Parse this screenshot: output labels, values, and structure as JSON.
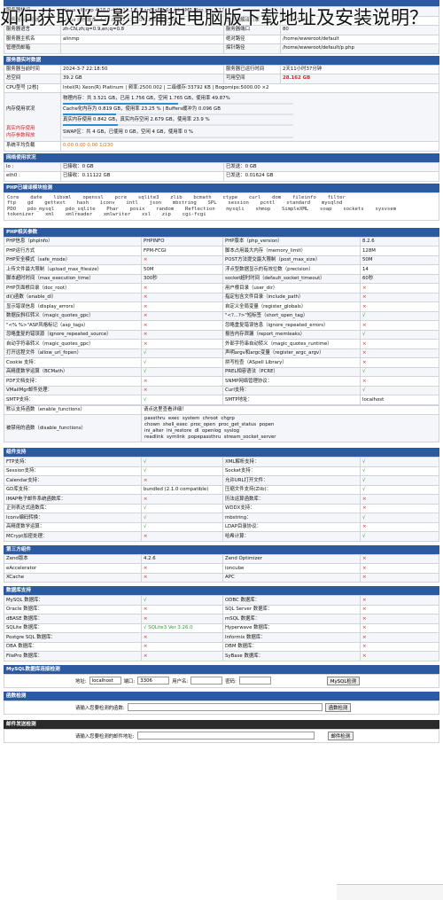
{
  "overlay_title": "如何获取光与影的捕捉电脑版下载地址及安装说明？",
  "top_rows": [
    [
      "服务器标识",
      "Linux alinmp 4.18.0-477.13.1.0.1.an8.x86_64 #1 SMP Mon Jun 5 13:33:33 CST 2023 x86_64",
      "",
      ""
    ],
    [
      "服务器操作系统",
      "Linux 内核版本: 4.18.0-477.13.1.0.1.an8.x86_64",
      "服务器解译引擎",
      "nginx/1.24.0"
    ],
    [
      "服务器语言",
      "zh-CN,zh;q=0.9,en;q=0.8",
      "服务器端口",
      "80"
    ],
    [
      "服务器主机名",
      "alinmp",
      "绝对路径",
      "/home/wwwroot/default"
    ],
    [
      "管理员邮箱",
      "",
      "探针路径",
      "/home/wwwroot/default/p.php"
    ]
  ],
  "realtime": {
    "header": "服务器实时数据",
    "time_label": "服务器当前时间",
    "time": "2024-3-7 22:18:50",
    "uptime_label": "服务器已运行时间",
    "uptime": "2天11小时37分钟",
    "total_label": "总空间",
    "total": "39.2 GB",
    "free_label": "可用空间",
    "free": "28.162 GB",
    "cpu_label": "CPU型号 [2核]",
    "cpu": "Intel(R) Xeon(R) Platinum | 频率:2500.002 | 二级缓存:33792 KB | Bogomips:5000.00 ×2",
    "mem_label": "内存使用状况",
    "mem_used_label": "真实内存使用",
    "mem_free_label": "内存参数释放",
    "mem_line1": "物理内存：共 3.521 GB，已用 1.756 GB，空闲 1.765 GB，使用率 49.87%",
    "mem_line2": "Cache化内存为 0.819 GB，使用率 23.25 % | Buffers缓冲为 0.096 GB",
    "mem_line3": "真实内存使用 0.842 GB，真实内存空闲 2.679 GB，使用率 23.9 %",
    "mem_line4": "SWAP区：共 4 GB，已使用 0 GB，空闲 4 GB，使用率 0 %",
    "load_label": "系统平均负载",
    "load": "0.00 0.00 0.00 1/230",
    "mem_pct": 49.87,
    "cache_pct": 23.25,
    "real_pct": 23.9,
    "swap_pct": 0
  },
  "network": {
    "header": "网络使用状况",
    "rows": [
      [
        "lo :",
        "已接收：0 GB",
        "已发送：0 GB"
      ],
      [
        "eth0 :",
        "已接收：0.11122 GB",
        "已发送：0.01624 GB"
      ]
    ]
  },
  "modules": {
    "header": "PHP已编译模块检测",
    "text": "Core  date  libxml  openssl  pcre  sqlite3  zlib  bcmath  ctype  curl  dom  fileinfo  filter\nftp  gd  gettext  hash  iconv  intl  json  mbstring  SPL  session  pcntl  standard  mysqlnd\nPDO  pdo_mysql  pdo_sqlite  Phar  posix  random  Reflection  mysqli  shmop  SimpleXML  soap  sockets  sysvsem\ntokenizer  xml  xmlreader  xmlwriter  xsl  zip  cgi-fcgi"
  },
  "php": {
    "header": "PHP相关参数",
    "rows": [
      [
        "PHP信息（phpinfo）",
        "PHPINFO",
        "PHP版本（php_version）",
        "8.2.6"
      ],
      [
        "PHP运行方式",
        "FPM-FCGI",
        "脚本占用最大内存（memory_limit）",
        "128M"
      ],
      [
        "PHP安全模式（safe_mode）",
        "×",
        "POST方法提交最大限制（post_max_size）",
        "50M"
      ],
      [
        "上传文件最大限制（upload_max_filesize）",
        "50M",
        "浮点型数据显示的有效位数（precision）",
        "14"
      ],
      [
        "脚本超时时间（max_execution_time）",
        "300秒",
        "socket超时时间（default_socket_timeout）",
        "60秒"
      ],
      [
        "PHP页面根目录（doc_root）",
        "×",
        "用户根目录（user_dir）",
        "×"
      ],
      [
        "dl()函数（enable_dl）",
        "×",
        "指定包含文件目录（include_path）",
        "×"
      ],
      [
        "显示错误信息（display_errors）",
        "×",
        "自定义全局变量（register_globals）",
        "×"
      ],
      [
        "数据反斜杠转义（magic_quotes_gpc）",
        "×",
        "\"<?...?>\"短标签（short_open_tag）",
        "√"
      ],
      [
        "\"<% %>\"ASP风格标记（asp_tags）",
        "×",
        "忽略重复错误信息（ignore_repeated_errors）",
        "×"
      ],
      [
        "忽略重复的错误源（ignore_repeated_source）",
        "×",
        "报告内存泄漏（report_memleaks）",
        "√"
      ],
      [
        "自动字符串转义（magic_quotes_gpc）",
        "×",
        "外部字符串自动转义（magic_quotes_runtime）",
        "×"
      ],
      [
        "打开远程文件（allow_url_fopen）",
        "√",
        "声明argv和argc变量（register_argc_argv）",
        "×"
      ],
      [
        "Cookie 支持：",
        "√",
        "拼写检查（ASpell Library）",
        "×"
      ],
      [
        "高精度数学运算（BCMath）",
        "√",
        "PREL相容语法（PCRE）",
        "√"
      ],
      [
        "PDF文档支持：",
        "×",
        "SNMP网络管理协议：",
        "×"
      ],
      [
        "VMailMgr邮件处理：",
        "×",
        "Curl支持：",
        "√"
      ],
      [
        "SMTP支持：",
        "√",
        "SMTP地址：",
        "localhost"
      ]
    ],
    "enabled_label": "默认支持函数（enable_functions）",
    "enabled_value": "请点这里查看详细！",
    "disabled_label": "被禁用的函数（disable_functions）",
    "disabled_value": "passthru  exec  system  chroot  chgrp\nchown  shell_exec  proc_open  proc_get_status  popen\nini_alter  ini_restore  dl  openlog  syslog\nreadlink  symlink  popepassthru  stream_socket_server"
  },
  "components": {
    "header": "组件支持",
    "rows": [
      [
        "FTP支持：",
        "√",
        "XML解析支持：",
        "√"
      ],
      [
        "Session支持：",
        "√",
        "Socket支持：",
        "√"
      ],
      [
        "Calendar支持：",
        "×",
        "允许URL打开文件：",
        "√"
      ],
      [
        "GD库支持：",
        "bundled (2.1.0 compatible)",
        "压缩文件支持(Zlib)：",
        "√"
      ],
      [
        "IMAP电子邮件系统函数库：",
        "×",
        "历法运算函数库：",
        "×"
      ],
      [
        "正则表达式函数库：",
        "√",
        "WDDX支持：",
        "×"
      ],
      [
        "Iconv编码转换：",
        "√",
        "mbstring：",
        "√"
      ],
      [
        "高精度数学运算：",
        "√",
        "LDAP目录协议：",
        "×"
      ],
      [
        "MCrypt加密处理：",
        "×",
        "哈希计算：",
        "√"
      ]
    ]
  },
  "third": {
    "header": "第三方组件",
    "rows": [
      [
        "Zend版本",
        "4.2.6",
        "Zend Optimizer",
        "×"
      ],
      [
        "eAccelerator",
        "×",
        "ioncube",
        "×"
      ],
      [
        "XCache",
        "×",
        "APC",
        "×"
      ]
    ]
  },
  "db": {
    "header": "数据库支持",
    "rows": [
      [
        "MySQL 数据库：",
        "√",
        "ODBC 数据库：",
        "×"
      ],
      [
        "Oracle 数据库：",
        "×",
        "SQL Server 数据库：",
        "×"
      ],
      [
        "dBASE 数据库：",
        "×",
        "mSQL 数据库：",
        "×"
      ],
      [
        "SQLite 数据库：",
        "√  SQLite3    Ver 3.26.0",
        "Hyperwave 数据库：",
        "×"
      ],
      [
        "Postgre SQL 数据库：",
        "×",
        "Informix 数据库：",
        "×"
      ],
      [
        "DBA 数据库：",
        "×",
        "DBM 数据库：",
        "×"
      ],
      [
        "FilePro 数据库：",
        "×",
        "SyBase 数据库：",
        "×"
      ]
    ]
  },
  "mysql_check": {
    "header": "MySQL数据库连接检测",
    "host_label": "地址:",
    "host": "localhost",
    "port_label": "端口:",
    "port": "3306",
    "user_label": "用户名:",
    "user": "",
    "pass_label": "密码:",
    "pass": "",
    "button": "MySQL检测"
  },
  "func_check": {
    "header": "函数检测",
    "label": "请输入您要检测的函数:",
    "button": "函数检测"
  },
  "mail_check": {
    "header": "邮件发送检测",
    "label": "请输入您要检测的邮件地址:",
    "button": "邮件检测"
  }
}
